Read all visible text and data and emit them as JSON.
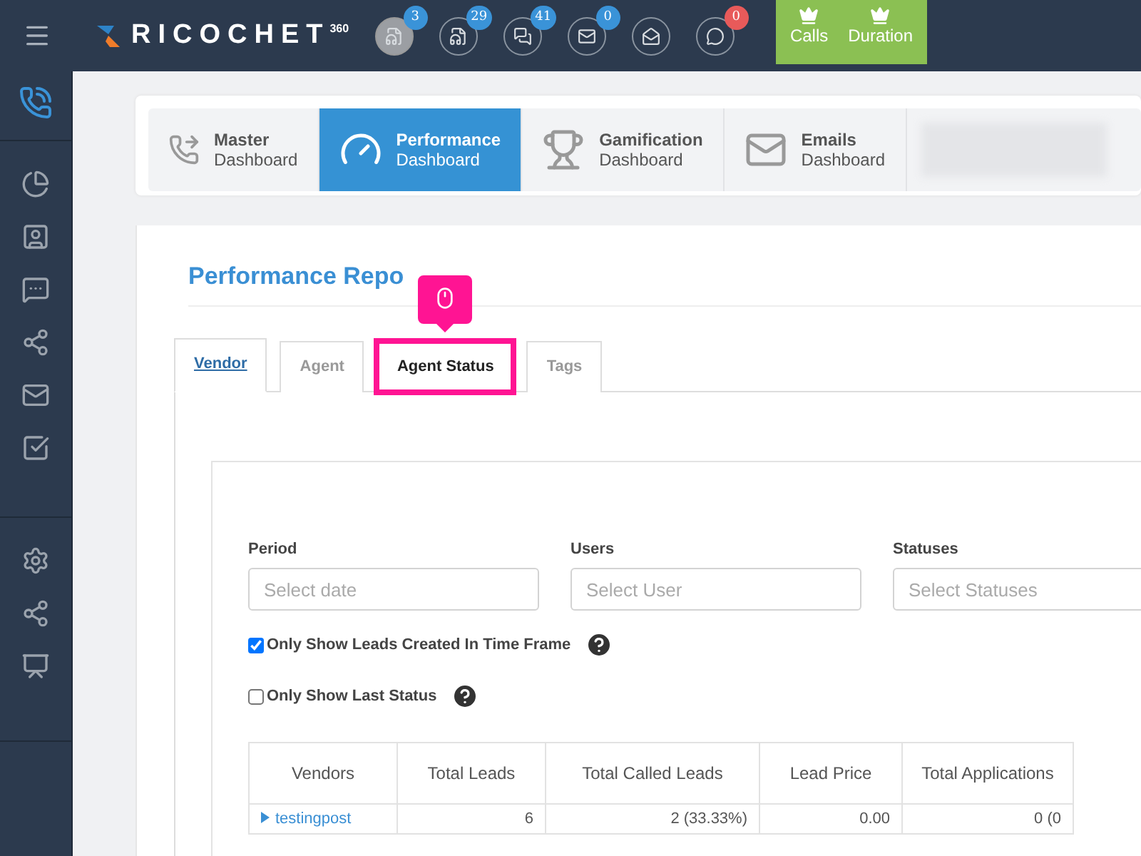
{
  "header": {
    "logo": "RICOCHET",
    "logo_sup": "360",
    "notifications": [
      {
        "count": "3",
        "selected": true,
        "color": "#3a93d8"
      },
      {
        "count": "29",
        "selected": false,
        "color": "#3a93d8"
      },
      {
        "count": "41",
        "selected": false,
        "color": "#3a93d8"
      },
      {
        "count": "0",
        "selected": false,
        "color": "#3a93d8"
      },
      {
        "selected": false
      },
      {
        "count": "0",
        "selected": false,
        "color": "#e85a5a"
      }
    ],
    "buttons": [
      "Calls",
      "Duration"
    ]
  },
  "dashboards": [
    {
      "kind": "phone",
      "title": "Master",
      "subtitle": "Dashboard",
      "selected": false
    },
    {
      "kind": "gauge",
      "title": "Performance",
      "subtitle": "Dashboard",
      "selected": true
    },
    {
      "kind": "trophy",
      "title": "Gamification",
      "subtitle": "Dashboard",
      "selected": false
    },
    {
      "kind": "mail",
      "title": "Emails",
      "subtitle": "Dashboard",
      "selected": false
    },
    {
      "kind": "blurred"
    }
  ],
  "report": {
    "title": "Performance Repo",
    "tabs": [
      {
        "label": "Vendor",
        "selected": true,
        "highlighted": false
      },
      {
        "label": "Agent",
        "selected": false,
        "highlighted": false
      },
      {
        "label": "Agent Status",
        "selected": false,
        "highlighted": true
      },
      {
        "label": "Tags",
        "selected": false,
        "highlighted": false
      }
    ],
    "filters": [
      {
        "label": "Period",
        "placeholder": "Select date"
      },
      {
        "label": "Users",
        "placeholder": "Select User"
      },
      {
        "label": "Statuses",
        "placeholder": "Select Statuses"
      }
    ],
    "options": [
      {
        "label": "Only Show Leads Created In Time Frame",
        "checked": true
      },
      {
        "label": "Only Show Last Status",
        "checked": false
      }
    ],
    "table": {
      "columns": [
        "Vendors",
        "Total Leads",
        "Total Called Leads",
        "Lead Price",
        "Total Applications"
      ],
      "rows": [
        [
          "testingpost",
          "6",
          "2 (33.33%)",
          "0.00",
          "0 (0"
        ]
      ]
    }
  }
}
